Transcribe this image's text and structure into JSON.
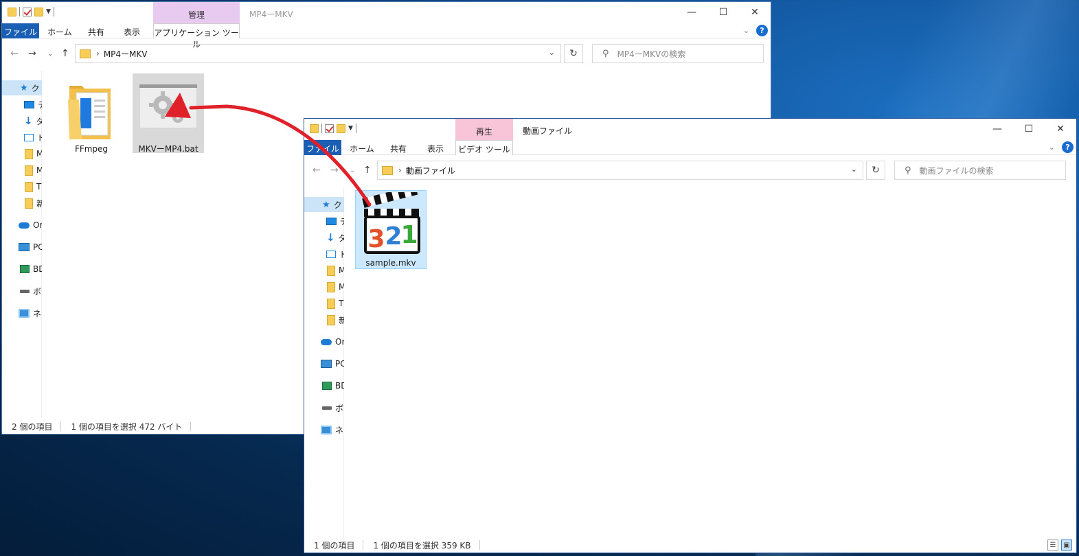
{
  "window1": {
    "title": "MP4ーMKV",
    "context_tab": "管理",
    "ribbon_tabs": [
      "ファイル",
      "ホーム",
      "共有",
      "表示",
      "アプリケーション ツール"
    ],
    "address_path": "MP4ーMKV",
    "search_placeholder": "MP4ーMKVの検索",
    "nav_items": [
      "ク",
      "デ",
      "ダ",
      "ド",
      "M",
      "M",
      "T",
      "新",
      "On",
      "PC",
      "BD",
      "ボ",
      "ネ"
    ],
    "files": [
      {
        "name": "FFmpeg",
        "icon": "folder-icon"
      },
      {
        "name": "MKVーMP4.bat",
        "icon": "batch-file-icon"
      }
    ],
    "status": {
      "count": "2 個の項目",
      "selection": "1 個の項目を選択  472 バイト"
    }
  },
  "window2": {
    "title": "動画ファイル",
    "context_tab": "再生",
    "ribbon_tabs": [
      "ファイル",
      "ホーム",
      "共有",
      "表示",
      "ビデオ ツール"
    ],
    "address_path": "動画ファイル",
    "search_placeholder": "動画ファイルの検索",
    "nav_items": [
      "ク",
      "デ",
      "ダ",
      "ド",
      "M",
      "M",
      "T",
      "新",
      "On",
      "PC",
      "BD",
      "ボ",
      "ネ"
    ],
    "files": [
      {
        "name": "sample.mkv",
        "icon": "media-player-classic-icon",
        "digits": [
          "3",
          "2",
          "1"
        ]
      }
    ],
    "status": {
      "count": "1 個の項目",
      "selection": "1 個の項目を選択  359 KB"
    }
  },
  "colors": {
    "accent": "#1a5fb4",
    "drag_arrow": "#e0212a",
    "selection": "#cce8ff",
    "manage_tab": "#e8c9f0",
    "play_tab": "#f7c4d8"
  }
}
